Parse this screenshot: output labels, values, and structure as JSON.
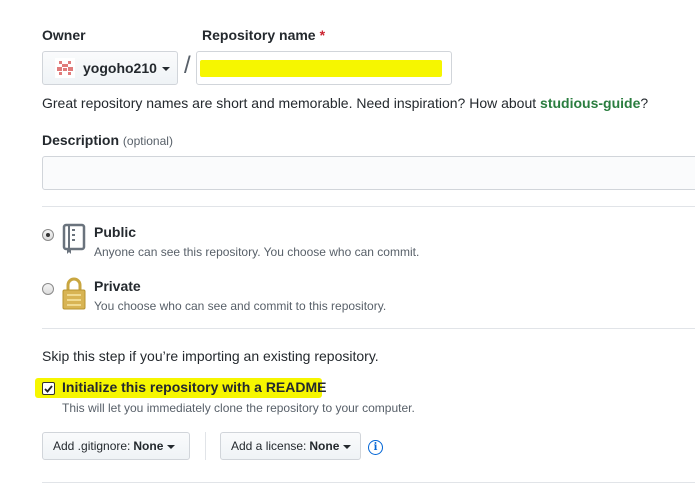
{
  "owner": {
    "label": "Owner",
    "selected": "yogoho210",
    "avatar_icon": "identicon-avatar"
  },
  "repo": {
    "label": "Repository name",
    "required_marker": "*",
    "separator": "/",
    "value": ""
  },
  "hint": {
    "text": "Great repository names are short and memorable. Need inspiration? How about ",
    "suggestion": "studious-guide",
    "suffix": "?"
  },
  "description": {
    "label": "Description",
    "optional": "(optional)",
    "value": ""
  },
  "visibility": {
    "options": [
      {
        "title": "Public",
        "desc": "Anyone can see this repository. You choose who can commit.",
        "icon": "repo-book-icon",
        "checked": true
      },
      {
        "title": "Private",
        "desc": "You choose who can see and commit to this repository.",
        "icon": "lock-icon",
        "checked": false
      }
    ]
  },
  "init": {
    "skip_text": "Skip this step if you’re importing an existing repository.",
    "readme_label": "Initialize this repository with a README",
    "readme_checked": true,
    "readme_desc": "This will let you immediately clone the repository to your computer."
  },
  "gitignore": {
    "label": "Add .gitignore:",
    "value": "None"
  },
  "license": {
    "label": "Add a license:",
    "value": "None"
  },
  "colors": {
    "highlight": "#f6f600",
    "link_green": "#28a745",
    "info_blue": "#0366d6"
  }
}
